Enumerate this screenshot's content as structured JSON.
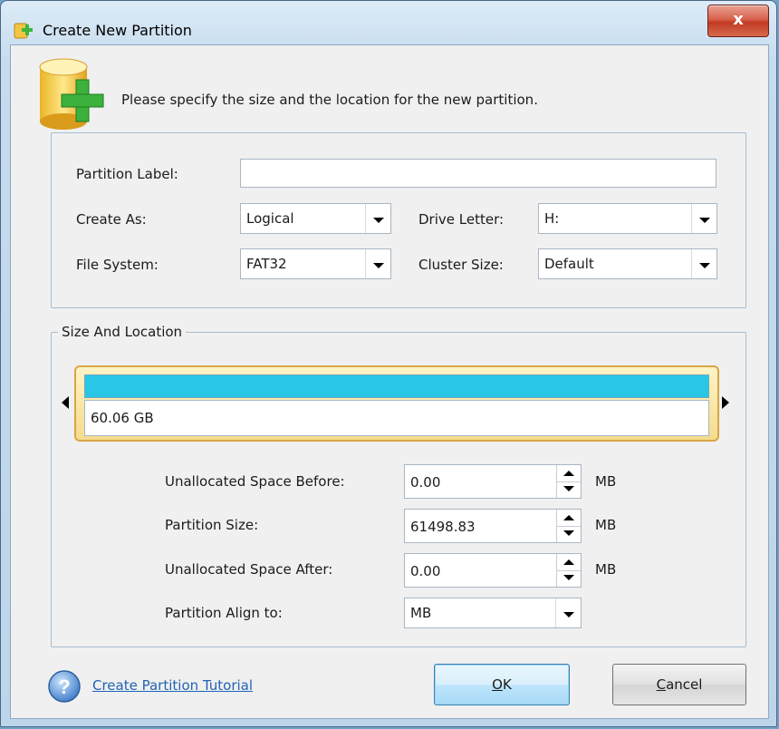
{
  "window": {
    "title": "Create New Partition",
    "close_glyph": "x",
    "icon": "add-partition-icon"
  },
  "header": {
    "instruction": "Please specify the size and the location for the new partition.",
    "icon": "database-plus-icon"
  },
  "settings": {
    "partition_label": {
      "label": "Partition Label:",
      "value": ""
    },
    "create_as": {
      "label": "Create As:",
      "value": "Logical"
    },
    "drive_letter": {
      "label": "Drive Letter:",
      "value": "H:"
    },
    "file_system": {
      "label": "File System:",
      "value": "FAT32"
    },
    "cluster_size": {
      "label": "Cluster Size:",
      "value": "Default"
    }
  },
  "size_location": {
    "legend": "Size And Location",
    "disk_bar": {
      "size_text": "60.06 GB",
      "fill_color": "#29c6e6",
      "fill_fraction": 1.0
    },
    "unallocated_before": {
      "label": "Unallocated Space Before:",
      "value": "0.00",
      "unit": "MB"
    },
    "partition_size": {
      "label": "Partition Size:",
      "value": "61498.83",
      "unit": "MB"
    },
    "unallocated_after": {
      "label": "Unallocated Space After:",
      "value": "0.00",
      "unit": "MB"
    },
    "align_to": {
      "label": "Partition Align to:",
      "value": "MB"
    }
  },
  "footer": {
    "help_link": "Create Partition Tutorial",
    "ok_label_accel": "O",
    "ok_label_rest": "K",
    "cancel_label_accel": "C",
    "cancel_label_rest": "ancel"
  },
  "colors": {
    "accent": "#29c6e6",
    "link": "#2063b5",
    "close_red": "#c23a22"
  }
}
